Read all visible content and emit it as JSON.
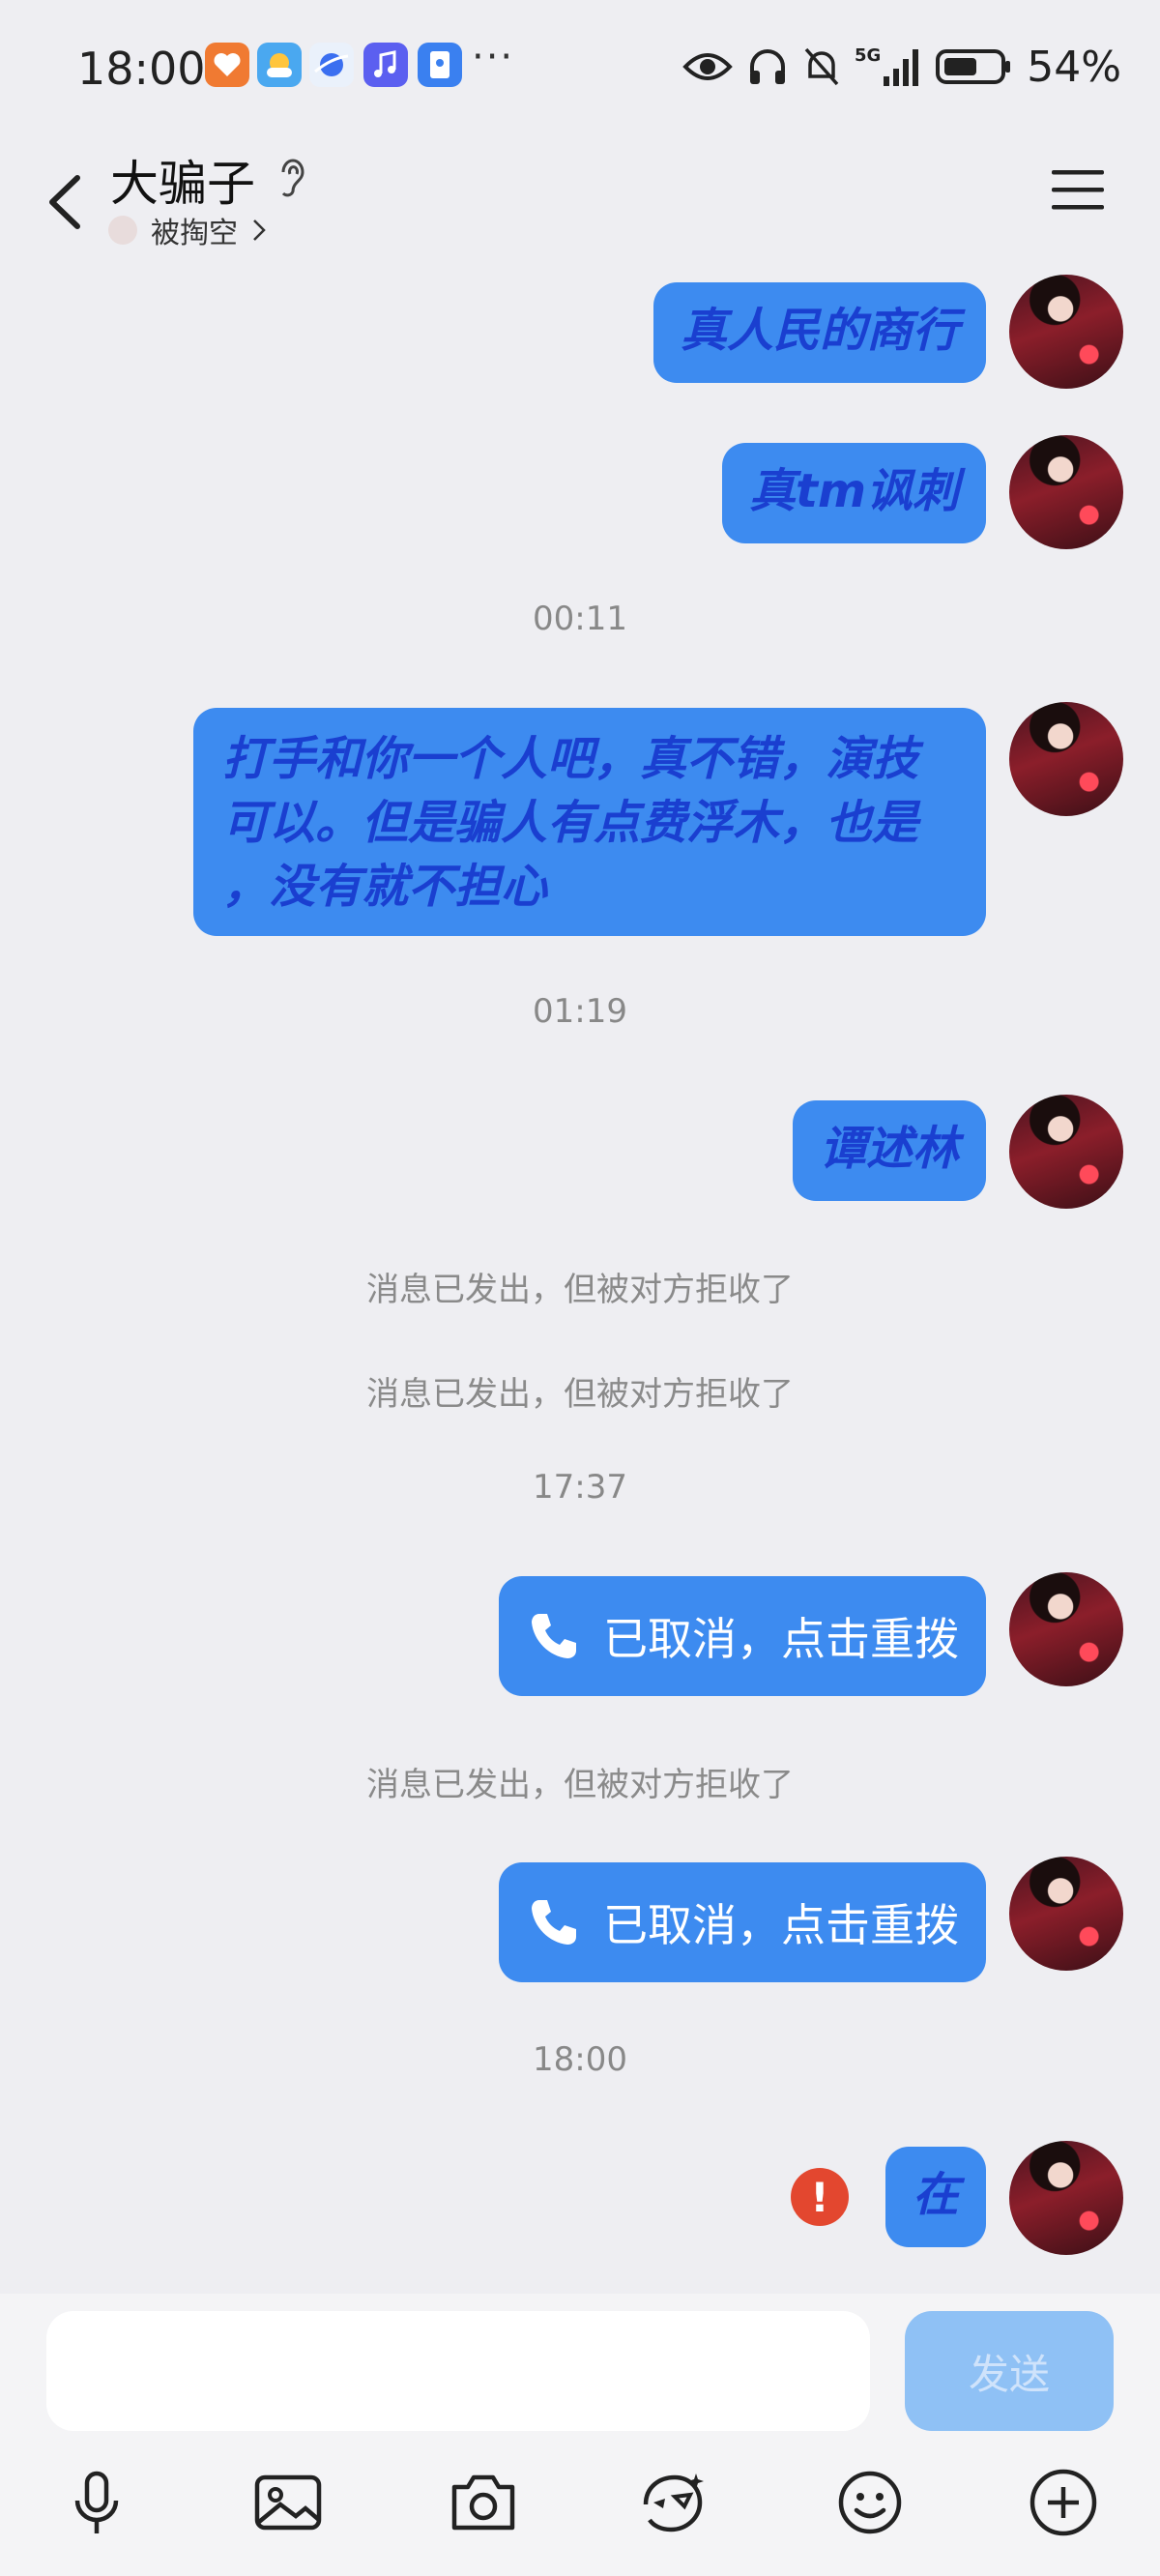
{
  "status_bar": {
    "time": "18:00",
    "battery": "54%",
    "network": "5G",
    "icons": [
      "health-app-icon",
      "weather-app-icon",
      "planet-app-icon",
      "music-app-icon",
      "files-app-icon",
      "more-dots",
      "eye-icon",
      "headphones-icon",
      "mute-icon",
      "signal-icon",
      "battery-icon"
    ]
  },
  "header": {
    "title": "大骗子",
    "subtitle": "被掏空"
  },
  "messages": [
    {
      "type": "text",
      "text": "真人民的商行"
    },
    {
      "type": "text",
      "text": "真tm讽刺"
    },
    {
      "type": "timestamp",
      "text": "00:11"
    },
    {
      "type": "text",
      "lines": [
        "打手和你一个人吧，真不错，演技",
        "可以。但是骗人有点费浮木，也是",
        "，没有就不担心"
      ]
    },
    {
      "type": "timestamp",
      "text": "01:19"
    },
    {
      "type": "text",
      "text": "谭述林"
    },
    {
      "type": "system",
      "text": "消息已发出，但被对方拒收了"
    },
    {
      "type": "system",
      "text": "消息已发出，但被对方拒收了"
    },
    {
      "type": "timestamp",
      "text": "17:37"
    },
    {
      "type": "call",
      "text": "已取消，点击重拨"
    },
    {
      "type": "system",
      "text": "消息已发出，但被对方拒收了"
    },
    {
      "type": "call",
      "text": "已取消，点击重拨"
    },
    {
      "type": "timestamp",
      "text": "18:00"
    },
    {
      "type": "text",
      "text": "在",
      "failed": true
    }
  ],
  "input": {
    "placeholder": "",
    "send_label": "发送"
  },
  "toolbar": [
    "microphone-icon",
    "image-icon",
    "camera-icon",
    "sticker-icon",
    "emoji-icon",
    "plus-icon"
  ],
  "colors": {
    "bubble": "#3d8bf0",
    "bubble_text": "#1a3fd0",
    "background": "#eeeef2",
    "error": "#e3472f",
    "send_button": "#8fc1f5"
  }
}
